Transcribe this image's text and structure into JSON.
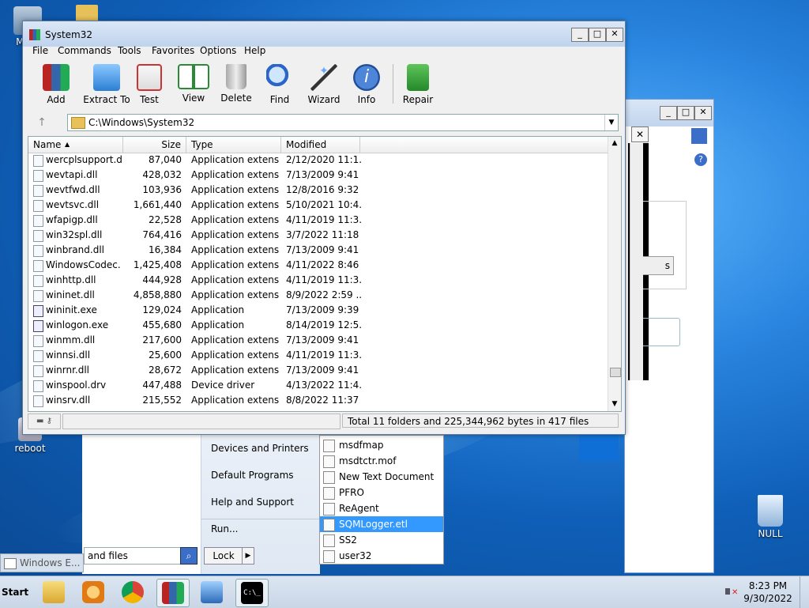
{
  "desktop": {
    "icons": [
      {
        "label": "My C"
      },
      {
        "label": "reboot"
      },
      {
        "label": "NULL"
      }
    ]
  },
  "window": {
    "title": "System32",
    "controls": {
      "minimize": "_",
      "maximize": "□",
      "close": "✕"
    },
    "menu": [
      "File",
      "Commands",
      "Tools",
      "Favorites",
      "Options",
      "Help"
    ],
    "toolbar": [
      "Add",
      "Extract To",
      "Test",
      "View",
      "Delete",
      "Find",
      "Wizard",
      "Info",
      "Repair"
    ],
    "address": "C:\\Windows\\System32",
    "columns": [
      "Name",
      "Size",
      "Type",
      "Modified"
    ],
    "rows": [
      {
        "name": "wercplsupport.dll",
        "size": "87,040",
        "type": "Application extens...",
        "modified": "2/12/2020 11:1..."
      },
      {
        "name": "wevtapi.dll",
        "size": "428,032",
        "type": "Application extens...",
        "modified": "7/13/2009 9:41 ..."
      },
      {
        "name": "wevtfwd.dll",
        "size": "103,936",
        "type": "Application extens...",
        "modified": "12/8/2016 9:32 ..."
      },
      {
        "name": "wevtsvc.dll",
        "size": "1,661,440",
        "type": "Application extens...",
        "modified": "5/10/2021 10:4..."
      },
      {
        "name": "wfapigp.dll",
        "size": "22,528",
        "type": "Application extens...",
        "modified": "4/11/2019 11:3..."
      },
      {
        "name": "win32spl.dll",
        "size": "764,416",
        "type": "Application extens...",
        "modified": "3/7/2022 11:18 ..."
      },
      {
        "name": "winbrand.dll",
        "size": "16,384",
        "type": "Application extens...",
        "modified": "7/13/2009 9:41 ..."
      },
      {
        "name": "WindowsCodec...",
        "size": "1,425,408",
        "type": "Application extens...",
        "modified": "4/11/2022 8:46 ..."
      },
      {
        "name": "winhttp.dll",
        "size": "444,928",
        "type": "Application extens...",
        "modified": "4/11/2019 11:3..."
      },
      {
        "name": "wininet.dll",
        "size": "4,858,880",
        "type": "Application extens...",
        "modified": "8/9/2022 2:59 ..."
      },
      {
        "name": "wininit.exe",
        "size": "129,024",
        "type": "Application",
        "modified": "7/13/2009 9:39 ..."
      },
      {
        "name": "winlogon.exe",
        "size": "455,680",
        "type": "Application",
        "modified": "8/14/2019 12:5..."
      },
      {
        "name": "winmm.dll",
        "size": "217,600",
        "type": "Application extens...",
        "modified": "7/13/2009 9:41 ..."
      },
      {
        "name": "winnsi.dll",
        "size": "25,600",
        "type": "Application extens...",
        "modified": "4/11/2019 11:3..."
      },
      {
        "name": "winrnr.dll",
        "size": "28,672",
        "type": "Application extens...",
        "modified": "7/13/2009 9:41 ..."
      },
      {
        "name": "winspool.drv",
        "size": "447,488",
        "type": "Device driver",
        "modified": "4/13/2022 11:4..."
      },
      {
        "name": "winsrv.dll",
        "size": "215,552",
        "type": "Application extens...",
        "modified": "8/8/2022 11:37 ..."
      }
    ],
    "status": "Total 11 folders and 225,344,962 bytes in 417 files"
  },
  "startmenu": {
    "right_items": [
      "Devices and Printers",
      "Default Programs",
      "Help and Support",
      "Run..."
    ],
    "search_text": "and files",
    "lock_label": "Lock"
  },
  "jumplist": {
    "items": [
      "msdfmap",
      "msdtctr.mof",
      "New Text Document",
      "PFRO",
      "ReAgent",
      "SQMLogger.etl",
      "SS2",
      "user32"
    ],
    "selected_index": 5
  },
  "taskbar": {
    "start_label": "Start",
    "explorer_label": "Windows E...",
    "time": "8:23 PM",
    "date": "9/30/2022"
  }
}
